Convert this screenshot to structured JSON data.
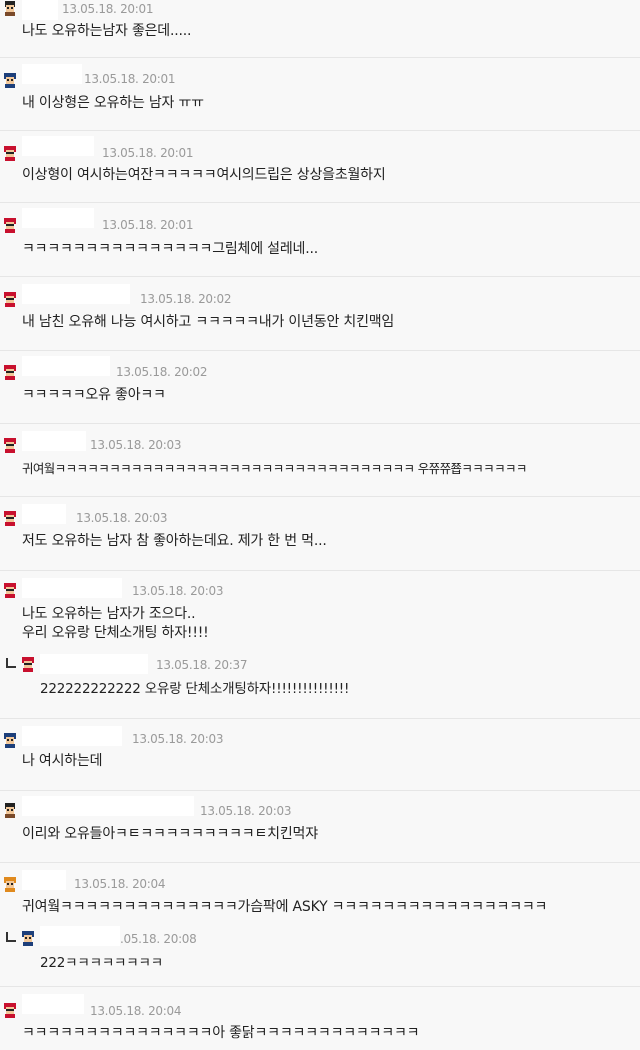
{
  "comments": [
    {
      "time": "13.05.18. 20:01",
      "lines": [
        "나도 오유하는남자 좋은데....."
      ],
      "avatar": "girl-avatar-icon"
    },
    {
      "time": "13.05.18. 20:01",
      "lines": [
        "내 이상형은 오유하는 남자 ㅠㅠ"
      ],
      "avatar": "navy-avatar-icon"
    },
    {
      "time": "13.05.18. 20:01",
      "lines": [
        "이상형이 여시하는여잔ㅋㅋㅋㅋㅋ여시의드립은 상상을초월하지"
      ],
      "avatar": "red-avatar-icon"
    },
    {
      "time": "13.05.18. 20:01",
      "lines": [
        "ㅋㅋㅋㅋㅋㅋㅋㅋㅋㅋㅋㅋㅋㅋㅋ그림체에 설레네..."
      ],
      "avatar": "red-avatar-icon"
    },
    {
      "time": "13.05.18. 20:02",
      "lines": [
        "내 남친 오유해 나능 여시하고 ㅋㅋㅋㅋㅋ내가 이년동안 치킨맥임"
      ],
      "avatar": "red-avatar-icon"
    },
    {
      "time": "13.05.18. 20:02",
      "lines": [
        "ㅋㅋㅋㅋㅋ오유 좋아ㅋㅋ"
      ],
      "avatar": "red-avatar-icon"
    },
    {
      "time": "13.05.18. 20:03",
      "lines": [
        "귀여웤ㅋㅋㅋㅋㅋㅋㅋㅋㅋㅋㅋㅋㅋㅋㅋㅋㅋㅋㅋㅋㅋㅋㅋㅋㅋㅋㅋㅋㅋㅋㅋㅋㅋ 우쮸쮸쬽ㅋㅋㅋㅋㅋㅋ"
      ],
      "avatar": "red-avatar-icon"
    },
    {
      "time": "13.05.18. 20:03",
      "lines": [
        "저도 오유하는 남자 참 좋아하는데요. 제가 한 번 먹..."
      ],
      "avatar": "red-avatar-icon"
    },
    {
      "time": "13.05.18. 20:03",
      "lines": [
        "나도 오유하는 남자가 조으다..",
        "우리 오유랑 단체소개팅 하자!!!!"
      ],
      "avatar": "red-avatar-icon"
    },
    {
      "reply": true,
      "time": "13.05.18. 20:37",
      "lines": [
        "222222222222 오유랑 단체소개팅하자!!!!!!!!!!!!!!!"
      ],
      "avatar": "red-avatar-icon"
    },
    {
      "time": "13.05.18. 20:03",
      "lines": [
        "나 여시하는데"
      ],
      "avatar": "navy-avatar-icon"
    },
    {
      "time": "13.05.18. 20:03",
      "lines": [
        "이리와 오유들아ㅋㅌㅋㅋㅋㅋㅋㅋㅋㅋㅋㅌ치킨먹쟈"
      ],
      "avatar": "girl-avatar-icon"
    },
    {
      "time": "13.05.18. 20:04",
      "lines": [
        "귀여웤ㅋㅋㅋㅋㅋㅋㅋㅋㅋㅋㅋㅋㅋㅋ가슴팍에 ASKY ㅋㅋㅋㅋㅋㅋㅋㅋㅋㅋㅋㅋㅋㅋㅋㅋㅋ"
      ],
      "avatar": "orange-avatar-icon"
    },
    {
      "reply": true,
      "time": ".05.18. 20:08",
      "lines": [
        "222ㅋㅋㅋㅋㅋㅋㅋㅋ"
      ],
      "avatar": "navy-avatar-icon"
    },
    {
      "time": "13.05.18. 20:04",
      "lines": [
        "ㅋㅋㅋㅋㅋㅋㅋㅋㅋㅋㅋㅋㅋㅋㅋ아 좋닭ㅋㅋㅋㅋㅋㅋㅋㅋㅋㅋㅋㅋㅋ"
      ],
      "avatar": "red-avatar-icon"
    }
  ],
  "colors": {
    "background": "#f8f8f8",
    "name_box": "#ffffff",
    "timestamp": "#9a9a9a",
    "text": "#222222",
    "avatar_red": "#c8102e",
    "avatar_navy": "#1d3f7a",
    "avatar_orange": "#e08a1e"
  }
}
